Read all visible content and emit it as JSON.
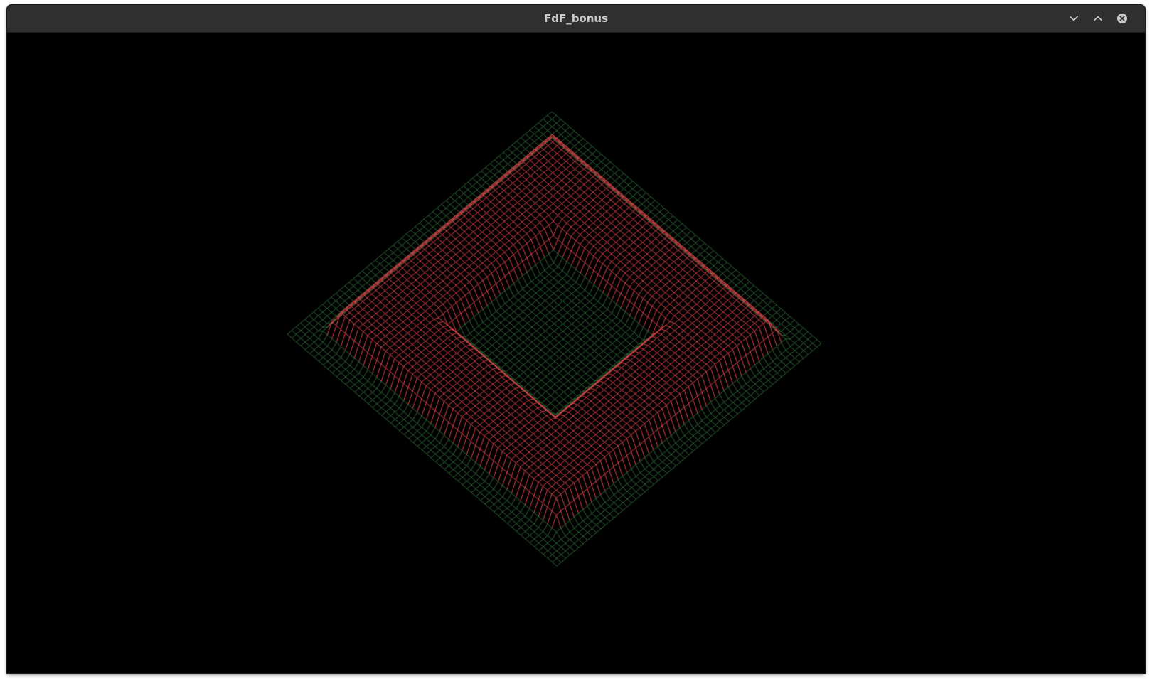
{
  "window": {
    "title": "FdF_bonus",
    "controls": {
      "minimize": "chevron-down-icon",
      "maximize": "chevron-up-icon",
      "close": "close-icon"
    }
  },
  "render": {
    "background_color": "#000000",
    "low_color": "#2f6b3a",
    "high_color": "#e0444a",
    "grid_resolution": 60,
    "projection": "isometric"
  }
}
